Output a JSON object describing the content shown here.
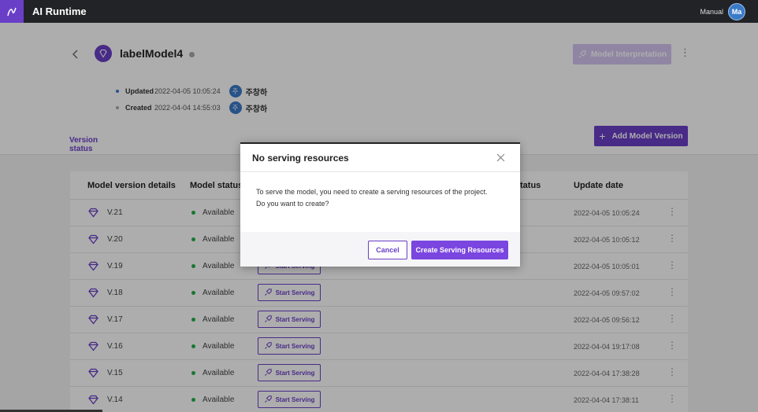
{
  "app": {
    "title": "AI Runtime",
    "user_name": "Manual",
    "avatar_initials": "Ma"
  },
  "model": {
    "name": "labelModel4",
    "interpretation_label": "Model Interpretation",
    "updated_label": "Updated",
    "updated_time": "2022-04-05 10:05:24",
    "created_label": "Created",
    "created_time": "2022-04-04 14:55:03",
    "user_initial": "주",
    "user_name": "주창하"
  },
  "tabs": {
    "version_status": "Version status"
  },
  "add_version_label": "Add Model Version",
  "table": {
    "headers": {
      "details": "Model version details",
      "status": "Model status",
      "serving_status": "tatus",
      "update_date": "Update date"
    },
    "rows": [
      {
        "version": "V.21",
        "status": "Available",
        "serve_label": "",
        "date": "2022-04-05 10:05:24"
      },
      {
        "version": "V.20",
        "status": "Available",
        "serve_label": "",
        "date": "2022-04-05 10:05:12"
      },
      {
        "version": "V.19",
        "status": "Available",
        "serve_label": "Start Serving",
        "date": "2022-04-05 10:05:01"
      },
      {
        "version": "V.18",
        "status": "Available",
        "serve_label": "Start Serving",
        "date": "2022-04-05 09:57:02"
      },
      {
        "version": "V.17",
        "status": "Available",
        "serve_label": "Start Serving",
        "date": "2022-04-05 09:56:12"
      },
      {
        "version": "V.16",
        "status": "Available",
        "serve_label": "Start Serving",
        "date": "2022-04-04 19:17:08"
      },
      {
        "version": "V.15",
        "status": "Available",
        "serve_label": "Start Serving",
        "date": "2022-04-04 17:38:28"
      },
      {
        "version": "V.14",
        "status": "Available",
        "serve_label": "Start Serving",
        "date": "2022-04-04 17:38:11"
      }
    ]
  },
  "modal": {
    "title": "No serving resources",
    "line1": "To serve the model, you need to create a serving resources of the project.",
    "line2": "Do you want to create?",
    "cancel_label": "Cancel",
    "create_label": "Create Serving Resources"
  },
  "colors": {
    "accent": "#6a3fc7",
    "topbar": "#222326",
    "available": "#22b04b"
  }
}
